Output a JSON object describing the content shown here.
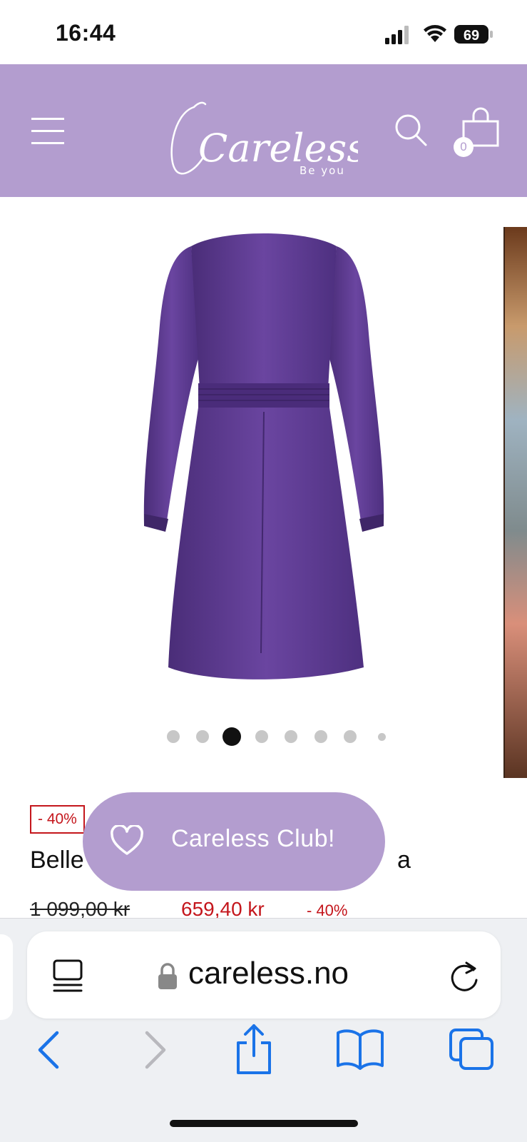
{
  "status_bar": {
    "time": "16:44",
    "battery": "69"
  },
  "header": {
    "logo_text": "Careless",
    "logo_tagline": "Be you",
    "cart_count": "0",
    "brand_color": "#b39dcf"
  },
  "carousel": {
    "total_dots": 8,
    "active_index": 2
  },
  "product": {
    "discount_badge": "- 40%",
    "title_visible_start": "Belle",
    "title_visible_end": "a",
    "old_price": "1 099,00 kr",
    "new_price": "659,40 kr",
    "price_discount": "- 40%",
    "dress_color": "#5b3a8e"
  },
  "club_button": {
    "label": "Careless Club!"
  },
  "browser": {
    "url": "careless.no"
  }
}
